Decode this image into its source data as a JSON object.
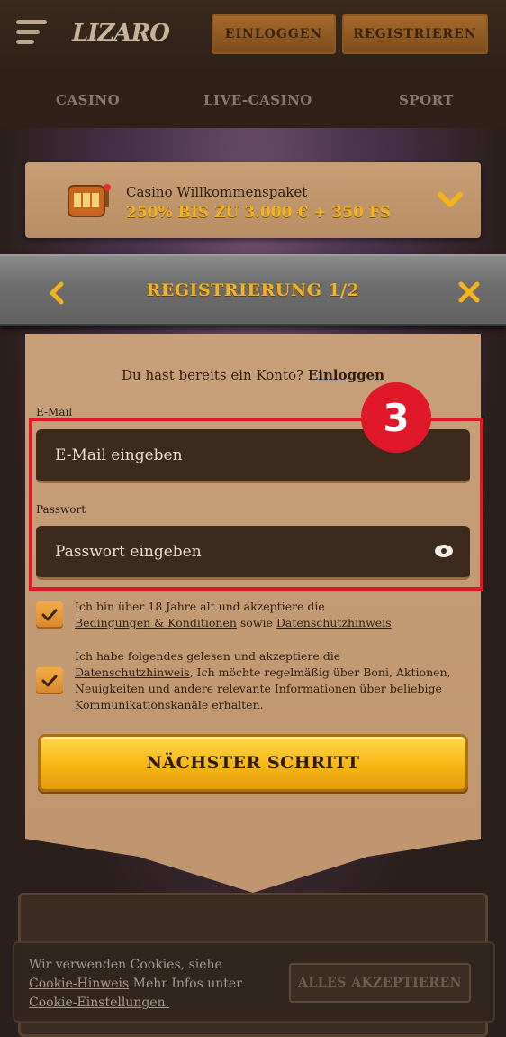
{
  "header": {
    "logo": "LIZARO",
    "login_label": "EINLOGGEN",
    "register_label": "REGISTRIEREN"
  },
  "nav": {
    "items": [
      "CASINO",
      "LIVE-CASINO",
      "SPORT"
    ]
  },
  "promo": {
    "title": "Casino Willkommenspaket",
    "subtitle": "250% BIS ZU 3.000 € + 350 FS"
  },
  "registration": {
    "title": "REGISTRIERUNG 1/2",
    "have_account_text": "Du hast bereits ein Konto?",
    "login_link": "Einloggen",
    "email_label": "E-Mail",
    "email_placeholder": "E-Mail eingeben",
    "password_label": "Passwort",
    "password_placeholder": "Passwort eingeben",
    "consent1": {
      "text_before": "Ich bin über 18 Jahre alt und akzeptiere die",
      "link1": "Bedingungen & Konditionen",
      "middle": "sowie",
      "link2": "Datenschutzhinweis",
      "checked": true
    },
    "consent2": {
      "text_before": "Ich habe folgendes gelesen und akzeptiere die",
      "link1": "Datenschutzhinweis",
      "text_after": ", Ich möchte regelmäßig über Boni, Aktionen, Neuigkeiten und andere relevante Informationen über beliebige Kommunikationskanäle erhalten.",
      "checked": true
    },
    "next_button": "NÄCHSTER SCHRITT"
  },
  "annotation": {
    "step_number": "3",
    "color": "#e1172a"
  },
  "cookie": {
    "text_before": "Wir verwenden Cookies, siehe",
    "link_hinweis": "Cookie-Hinweis",
    "text_middle": "Mehr Infos unter",
    "link_settings": "Cookie-Einstellungen.",
    "accept_label": "ALLES AKZEPTIEREN"
  },
  "colors": {
    "accent_gold": "#f4b21c",
    "parchment": "#c7a07a",
    "input_bg": "#3c2a1d"
  }
}
